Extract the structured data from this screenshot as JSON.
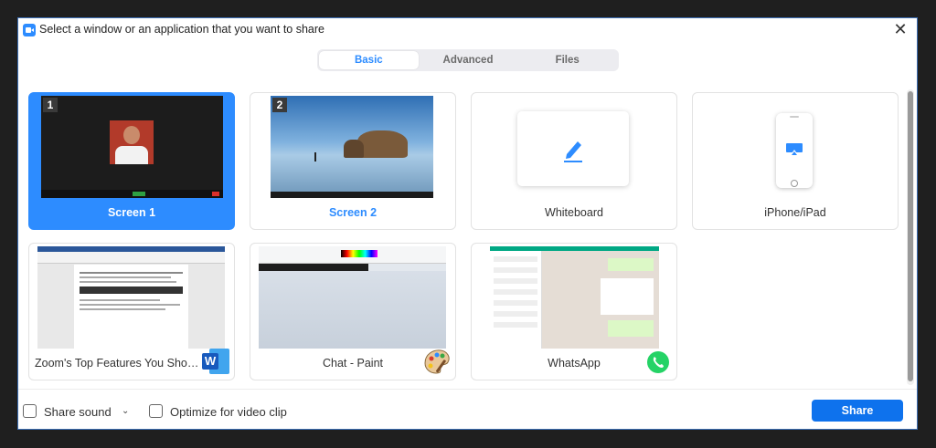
{
  "window": {
    "title": "Select a window or an application that you want to share",
    "close_glyph": "✕"
  },
  "tabs": [
    {
      "label": "Basic",
      "active": true
    },
    {
      "label": "Advanced",
      "active": false
    },
    {
      "label": "Files",
      "active": false
    }
  ],
  "tiles": [
    {
      "label": "Screen 1",
      "badge": "1",
      "selected": true
    },
    {
      "label": "Screen 2",
      "badge": "2",
      "selected": false
    },
    {
      "label": "Whiteboard",
      "icon": "pen-icon"
    },
    {
      "label": "iPhone/iPad",
      "icon": "airplay-icon"
    },
    {
      "label": "Zoom's Top Features You Should...",
      "app_icon": "word-icon",
      "app_icon_text": "W"
    },
    {
      "label": "Chat - Paint",
      "app_icon": "paint-palette-icon"
    },
    {
      "label": "WhatsApp",
      "app_icon": "whatsapp-icon"
    }
  ],
  "footer": {
    "share_sound_label": "Share sound",
    "share_sound_checked": false,
    "optimize_label": "Optimize for video clip",
    "optimize_checked": false,
    "share_button": "Share"
  },
  "colors": {
    "accent": "#2d8cff",
    "share_button": "#0e72ed"
  }
}
